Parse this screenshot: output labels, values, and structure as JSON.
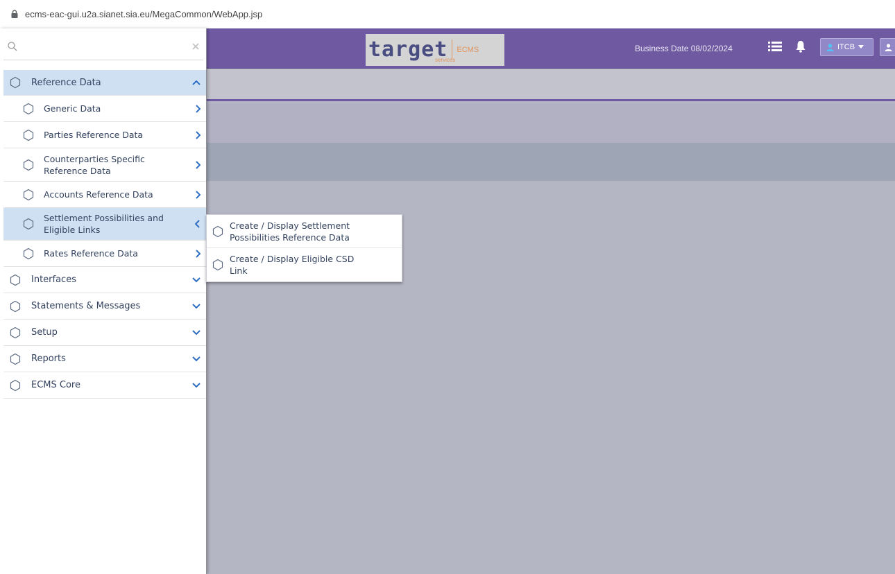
{
  "address_bar": {
    "url": "ecms-eac-gui.u2a.sianet.sia.eu/MegaCommon/WebApp.jsp"
  },
  "header": {
    "logo_word": "target",
    "logo_suffix": "ECMS",
    "logo_tagline": "services",
    "business_date": "Business Date 08/02/2024",
    "user_label": "ITCB"
  },
  "colors": {
    "header_purple": "#6f5aa2",
    "active_item_bg": "#cfe0f3",
    "menu_text": "#33425e",
    "chevron_blue": "#2d6ec3"
  },
  "sidebar": {
    "search": {
      "placeholder": "",
      "value": ""
    },
    "items": [
      {
        "label": "Reference Data",
        "expanded": true,
        "children": [
          {
            "label": "Generic Data"
          },
          {
            "label": "Parties Reference Data"
          },
          {
            "label": "Counterparties Specific Reference Data"
          },
          {
            "label": "Accounts Reference Data"
          },
          {
            "label": "Settlement Possibilities and Eligible Links",
            "active": true
          },
          {
            "label": "Rates Reference Data"
          }
        ]
      },
      {
        "label": "Interfaces"
      },
      {
        "label": "Statements & Messages"
      },
      {
        "label": "Setup"
      },
      {
        "label": "Reports"
      },
      {
        "label": "ECMS Core"
      }
    ]
  },
  "flyout": {
    "items": [
      {
        "label": "Create / Display Settlement Possibilities Reference Data"
      },
      {
        "label": "Create / Display Eligible CSD Link"
      }
    ]
  }
}
